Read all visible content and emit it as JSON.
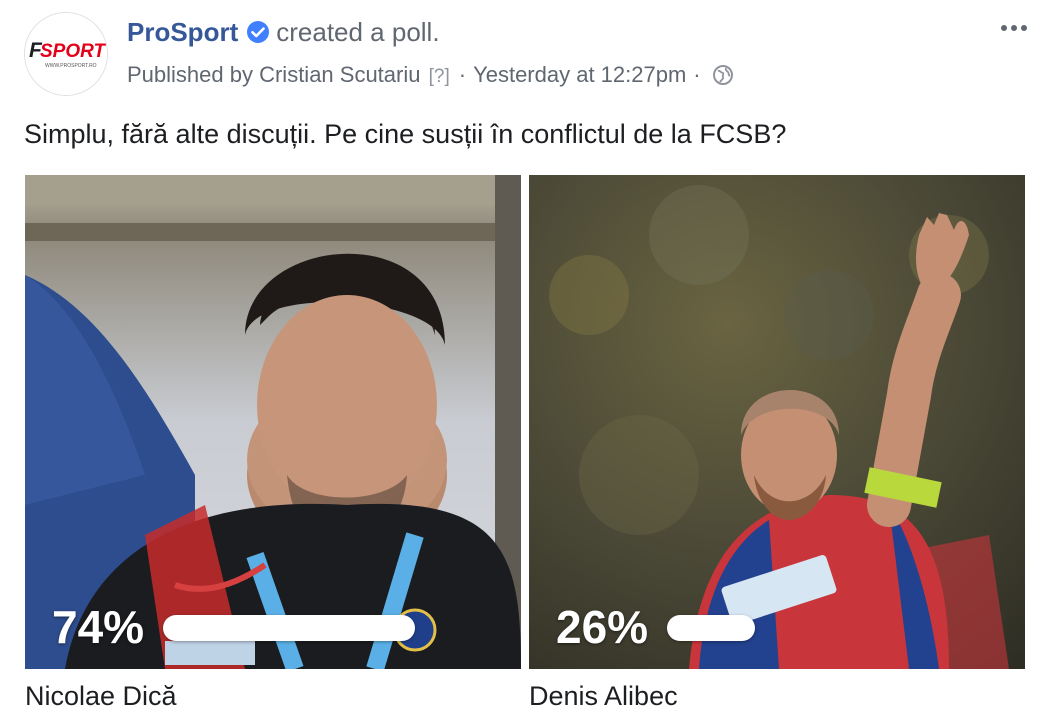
{
  "post": {
    "page_name": "ProSport",
    "action_text": "created a poll.",
    "published_by": "Published by Cristian Scutariu",
    "help_marker": "[?]",
    "separator": "·",
    "timestamp": "Yesterday at 12:27pm",
    "privacy_icon": "globe-icon",
    "more_icon": "more-horizontal-icon",
    "question": "Simplu, fără alte discuții. Pe cine susții în conflictul de la FCSB?"
  },
  "avatar": {
    "logo_text": "SPORT",
    "logo_prefix": "F",
    "logo_url_text": "WWW.PROSPORT.RO"
  },
  "poll": {
    "options": [
      {
        "percent_label": "74%",
        "fraction": 0.74,
        "name": "Nicolae Dică"
      },
      {
        "percent_label": "26%",
        "fraction": 0.26,
        "name": "Denis Alibec"
      }
    ]
  },
  "colors": {
    "link": "#365899",
    "muted": "#606770",
    "verified": "#4080ff",
    "brand_red": "#e2001a"
  }
}
